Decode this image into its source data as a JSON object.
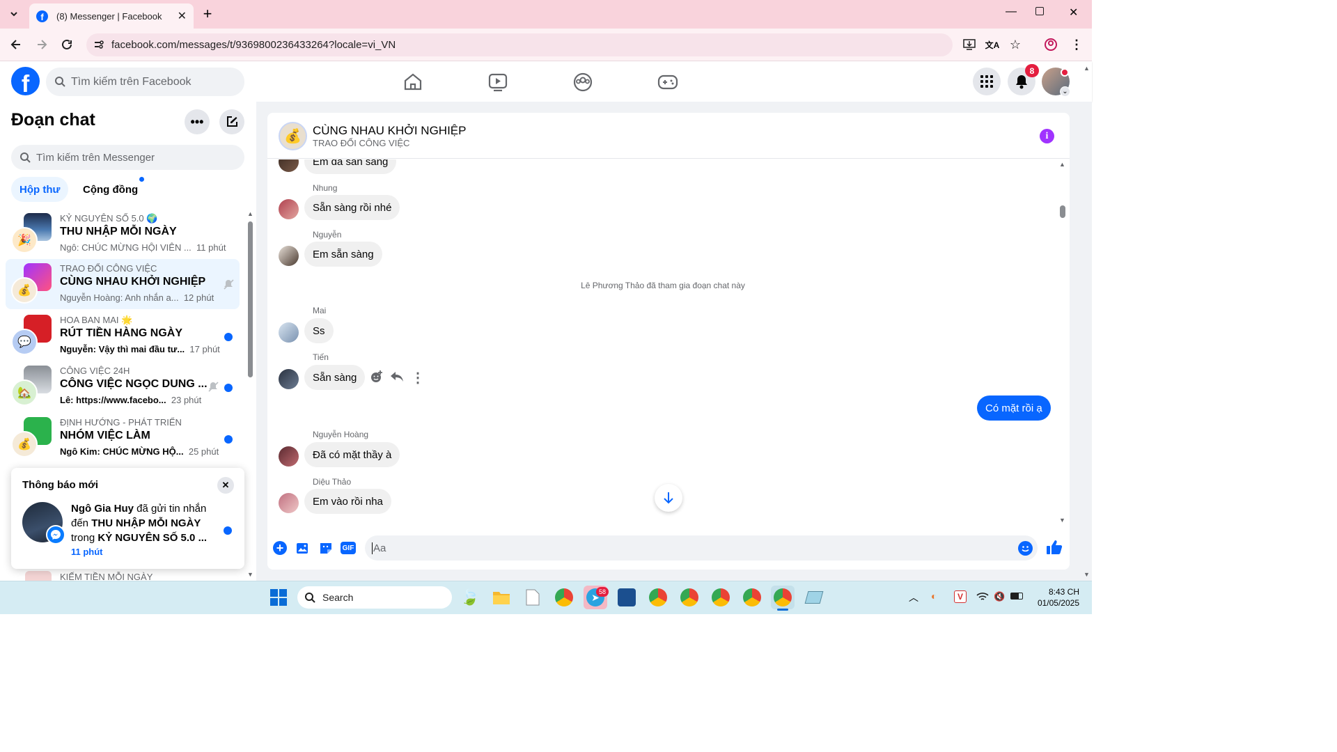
{
  "browser": {
    "tab_title": "(8) Messenger | Facebook",
    "url": "facebook.com/messages/t/9369800236433264?locale=vi_VN"
  },
  "fb": {
    "search_placeholder": "Tìm kiếm trên Facebook",
    "notif_count": "8",
    "brand_color": "#0866ff"
  },
  "sidebar": {
    "title": "Đoạn chat",
    "search_placeholder": "Tìm kiếm trên Messenger",
    "tab_inbox": "Hộp thư",
    "tab_community": "Cộng đồng",
    "conversations": [
      {
        "sub": "KỶ NGUYÊN SỐ 5.0 🌍",
        "name": "THU NHẬP MỖI NGÀY",
        "last": "Ngô: CHÚC MỪNG HỘI VIÊN ...",
        "time": "11 phút"
      },
      {
        "sub": "TRAO ĐỔI CÔNG VIỆC",
        "name": "CÙNG NHAU KHỞI NGHIỆP",
        "last": "Nguyễn Hoàng: Anh nhắn a...",
        "time": "12 phút"
      },
      {
        "sub": "HOA BAN MAI 🌟",
        "name": "RÚT TIỀN HÀNG NGÀY",
        "last": "Nguyễn: Vậy thì mai đầu tư...",
        "time": "17 phút"
      },
      {
        "sub": "CÔNG VIỆC 24H",
        "name": "CÔNG VIỆC NGỌC DUNG ...",
        "last": "Lê: https://www.facebo...",
        "time": "23 phút"
      },
      {
        "sub": "ĐỊNH HƯỚNG - PHÁT TRIỂN",
        "name": "NHÓM VIỆC LÀM",
        "last": "Ngô Kim: CHÚC MỪNG HỘ...",
        "time": "25 phút"
      },
      {
        "sub": "KIẾM TIỀN MỖI NGÀY"
      }
    ]
  },
  "notification": {
    "title": "Thông báo mới",
    "sender": "Ngô Gia Huy",
    "text1": " đã gửi tin nhắn",
    "text2": "đến ",
    "group": "THU NHẬP MỖI NGÀY",
    "text3": "trong ",
    "community": "KỶ NGUYÊN SỐ 5.0 ...",
    "time": "11 phút"
  },
  "chat": {
    "name": "CÙNG NHAU KHỞI NGHIỆP",
    "subtitle": "TRAO ĐỔI CÔNG VIỆC",
    "system_msg": "Lê Phương Thảo đã tham gia đoạn chat này",
    "messages": [
      {
        "sender": "",
        "text": "Em đã sẵn sàng"
      },
      {
        "sender": "Nhung",
        "text": "Sẵn sàng rồi nhé"
      },
      {
        "sender": "Nguyễn",
        "text": "Em sẵn sàng"
      },
      {
        "sender": "Mai",
        "text": "Ss"
      },
      {
        "sender": "Tiến",
        "text": "Sẵn sàng"
      },
      {
        "sender": "Nguyễn Hoàng",
        "text": "Đã có mặt thầy à"
      },
      {
        "sender": "Diệu Thảo",
        "text": "Em vào rồi nha"
      }
    ],
    "my_message": "Có mặt rồi ạ",
    "composer_placeholder": "Aa"
  },
  "taskbar": {
    "search_placeholder": "Search",
    "telegram_badge": "58",
    "time": "8:43 CH",
    "date": "01/05/2025"
  }
}
